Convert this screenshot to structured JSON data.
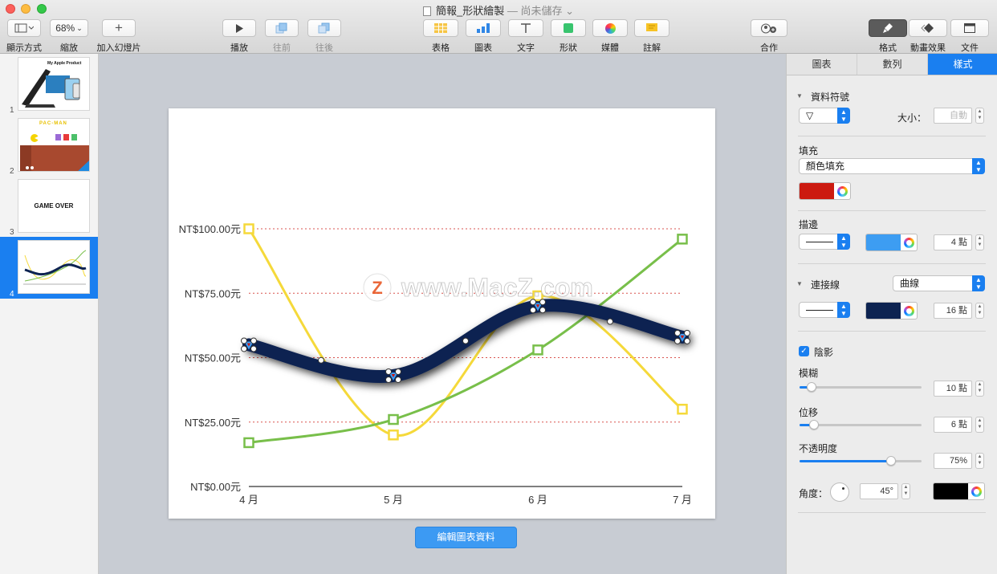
{
  "window": {
    "title": "簡報_形狀繪製",
    "status": "— 尚未儲存",
    "status_chevron": "⌄"
  },
  "toolbar": {
    "view_label": "顯示方式",
    "zoom_value": "68%",
    "zoom_label": "縮放",
    "add_slide_label": "加入幻燈片",
    "play_label": "播放",
    "forward_label": "往前",
    "backward_label": "往後",
    "table_label": "表格",
    "chart_label": "圖表",
    "text_label": "文字",
    "shape_label": "形狀",
    "media_label": "媒體",
    "comment_label": "註解",
    "collaborate_label": "合作",
    "format_label": "格式",
    "animate_label": "動畫效果",
    "document_label": "文件"
  },
  "navigator": {
    "slides": [
      {
        "num": "1",
        "thumb_text": "My Apple Product"
      },
      {
        "num": "2",
        "thumb_text": "PAC-MAN"
      },
      {
        "num": "3",
        "thumb_text": "GAME OVER"
      },
      {
        "num": "4",
        "thumb_text": ""
      }
    ]
  },
  "watermark": {
    "text": "www.MacZ.com",
    "logo_letter": "Z"
  },
  "edit_chart_button": "編輯圖表資料",
  "inspector": {
    "tabs": [
      "圖表",
      "數列",
      "樣式"
    ],
    "data_symbol_heading": "資料符號",
    "symbol_value": "▽",
    "size_label": "大小：",
    "size_placeholder": "自動",
    "fill_heading": "填充",
    "fill_type": "顏色填充",
    "fill_color": "#cc1a10",
    "stroke_heading": "描邊",
    "stroke_color": "#3d9df2",
    "stroke_width": "4 點",
    "connect_heading": "連接線",
    "connect_type": "曲線",
    "connect_color": "#0d2351",
    "connect_width": "16 點",
    "shadow_label": "陰影",
    "shadow_checked": true,
    "blur_label": "模糊",
    "blur_value": "10 點",
    "blur_level": 0.1,
    "offset_label": "位移",
    "offset_value": "6 點",
    "offset_level": 0.12,
    "opacity_label": "不透明度",
    "opacity_value": "75%",
    "opacity_level": 0.75,
    "angle_label": "角度：",
    "angle_value": "45°",
    "shadow_color": "#000000"
  },
  "chart_data": {
    "type": "line",
    "categories": [
      "4 月",
      "5 月",
      "6 月",
      "7 月"
    ],
    "y_ticks": [
      "NT$0.00元",
      "NT$25.00元",
      "NT$50.00元",
      "NT$75.00元",
      "NT$100.00元"
    ],
    "ylim": [
      0,
      100
    ],
    "grid": "dotted-red",
    "series": [
      {
        "values": [
          100,
          20,
          74,
          30
        ],
        "color": "#f5d93a",
        "symbol": "square",
        "smooth": true
      },
      {
        "values": [
          17,
          26,
          53,
          96
        ],
        "color": "#78bf4a",
        "symbol": "square",
        "smooth": true
      },
      {
        "values": [
          55,
          43,
          70,
          58
        ],
        "color": "#0d2351",
        "symbol": "triangle",
        "smooth": true,
        "selected": true
      }
    ]
  }
}
